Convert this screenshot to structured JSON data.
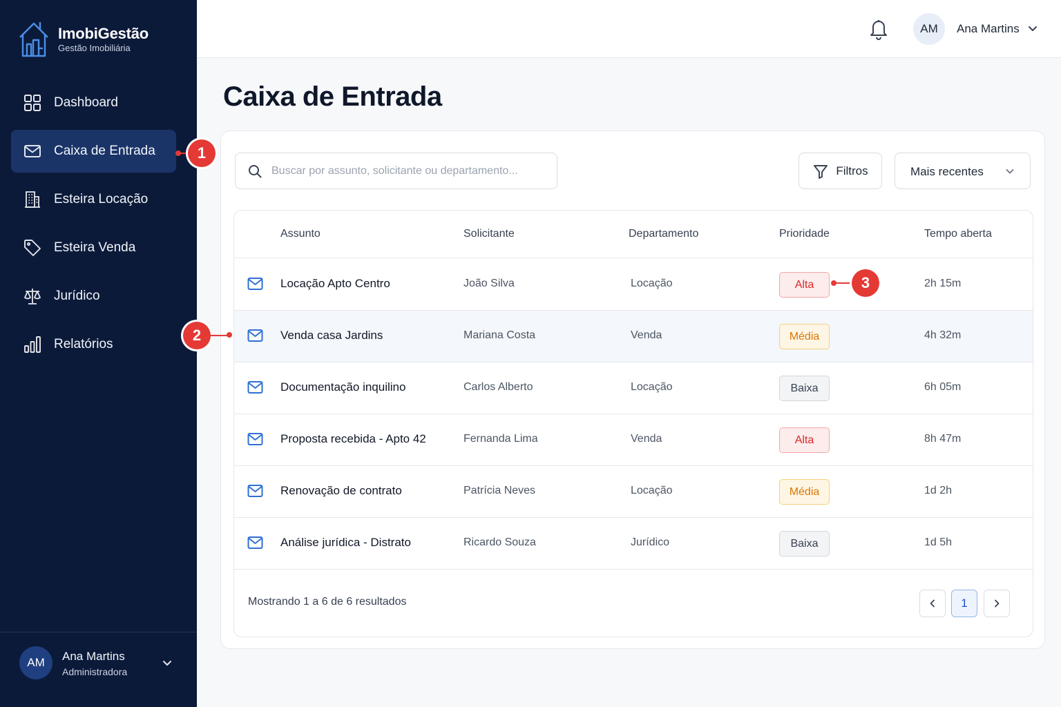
{
  "brand": {
    "name": "ImobiGestão",
    "subtitle": "Gestão Imobiliária",
    "logo_icon": "building-house-icon"
  },
  "sidebar": {
    "items": [
      {
        "label": "Dashboard",
        "icon": "grid-icon",
        "active": false
      },
      {
        "label": "Caixa de Entrada",
        "icon": "mail-icon",
        "active": true
      },
      {
        "label": "Esteira Locação",
        "icon": "building-icon",
        "active": false
      },
      {
        "label": "Esteira Venda",
        "icon": "tag-icon",
        "active": false
      },
      {
        "label": "Jurídico",
        "icon": "scale-icon",
        "active": false
      },
      {
        "label": "Relatórios",
        "icon": "bar-chart-icon",
        "active": false
      }
    ],
    "user": {
      "initials": "AM",
      "name": "Ana Martins",
      "role": "Administradora"
    }
  },
  "topbar": {
    "initials": "AM",
    "user_name": "Ana Martins"
  },
  "page": {
    "title": "Caixa de Entrada"
  },
  "toolbar": {
    "search_placeholder": "Buscar por assunto, solicitante ou departamento...",
    "filter_label": "Filtros",
    "sort_label": "Mais recentes"
  },
  "table": {
    "headers": {
      "subject": "Assunto",
      "requester": "Solicitante",
      "department": "Departamento",
      "priority": "Prioridade",
      "time_open": "Tempo aberta"
    },
    "rows": [
      {
        "subject": "Locação Apto Centro",
        "requester": "João Silva",
        "department": "Locação",
        "priority": "Alta",
        "priority_level": "alta",
        "time_open": "2h 15m"
      },
      {
        "subject": "Venda casa Jardins",
        "requester": "Mariana Costa",
        "department": "Venda",
        "priority": "Média",
        "priority_level": "media",
        "time_open": "4h 32m"
      },
      {
        "subject": "Documentação inquilino",
        "requester": "Carlos Alberto",
        "department": "Locação",
        "priority": "Baixa",
        "priority_level": "baixa",
        "time_open": "6h 05m"
      },
      {
        "subject": "Proposta recebida - Apto 42",
        "requester": "Fernanda Lima",
        "department": "Venda",
        "priority": "Alta",
        "priority_level": "alta",
        "time_open": "8h 47m"
      },
      {
        "subject": "Renovação de contrato",
        "requester": "Patrícia Neves",
        "department": "Locação",
        "priority": "Média",
        "priority_level": "media",
        "time_open": "1d 2h"
      },
      {
        "subject": "Análise jurídica - Distrato",
        "requester": "Ricardo Souza",
        "department": "Jurídico",
        "priority": "Baixa",
        "priority_level": "baixa",
        "time_open": "1d 5h"
      }
    ],
    "footer": {
      "showing": "Mostrando 1 a 6 de 6 resultados",
      "current_page": "1"
    }
  },
  "callouts": {
    "one": "1",
    "two": "2",
    "three": "3"
  },
  "colors": {
    "sidebar_bg": "#0c1a3a",
    "active_bg": "#1b3468",
    "accent": "#2f6fd6",
    "callout": "#e53935"
  }
}
